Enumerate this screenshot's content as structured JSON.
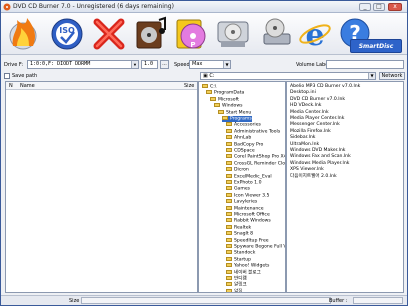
{
  "window": {
    "title": "DVD CD Burner 7.0 - Unregistered (6 days remaining)"
  },
  "toolbar": {
    "buttons": [
      {
        "icon": "burn-flame-icon"
      },
      {
        "icon": "iso-disc-icon",
        "label": "ISO"
      },
      {
        "icon": "erase-x-icon"
      },
      {
        "icon": "music-disc-icon"
      },
      {
        "icon": "dvd-disc-icon"
      },
      {
        "icon": "settings-disc-icon"
      },
      {
        "icon": "copy-drive-icon"
      },
      {
        "icon": "internet-explorer-icon"
      },
      {
        "icon": "help-question-icon",
        "label": "?"
      }
    ],
    "brand_label": "SmartDisc"
  },
  "drive": {
    "label": "Drive F:",
    "value": "1:0:0,F: DIODT  DDRMM",
    "speed_value": "1.0",
    "browse_label": "...",
    "speed_label": "Speed:",
    "speed_select": "Max",
    "volume_label": "Volume Label:"
  },
  "options": {
    "save_path_label": "Save path",
    "drive_select": "▣ C:",
    "network_label": "Network"
  },
  "file_list": {
    "columns": [
      "N",
      "Name",
      "Size"
    ]
  },
  "tree": {
    "items": [
      {
        "label": "C:\\",
        "depth": 0
      },
      {
        "label": "ProgramData",
        "depth": 1
      },
      {
        "label": "Microsoft",
        "depth": 2
      },
      {
        "label": "Windows",
        "depth": 3
      },
      {
        "label": "Start Menu",
        "depth": 4
      },
      {
        "label": "Programs",
        "depth": 5,
        "selected": true
      },
      {
        "label": "Accessories",
        "depth": 6
      },
      {
        "label": "Administrative Tools",
        "depth": 6
      },
      {
        "label": "AhnLab",
        "depth": 6
      },
      {
        "label": "BadCopy Pro",
        "depth": 6
      },
      {
        "label": "CDSpace",
        "depth": 6
      },
      {
        "label": "Corel PaintShop Pro X4",
        "depth": 6
      },
      {
        "label": "CrossGL Reminder Clock",
        "depth": 6
      },
      {
        "label": "Dicron",
        "depth": 6
      },
      {
        "label": "ExcelMedic_Eval",
        "depth": 6
      },
      {
        "label": "ExPhoto 1.0",
        "depth": 6
      },
      {
        "label": "Games",
        "depth": 6
      },
      {
        "label": "Icon Viewer 3.5",
        "depth": 6
      },
      {
        "label": "Lavyleries",
        "depth": 6
      },
      {
        "label": "Maintenance",
        "depth": 6
      },
      {
        "label": "Microsoft Office",
        "depth": 6
      },
      {
        "label": "Rabbit Windows",
        "depth": 6
      },
      {
        "label": "Realtek",
        "depth": 6
      },
      {
        "label": "SnagIt 8",
        "depth": 6
      },
      {
        "label": "SpeedItup Free",
        "depth": 6
      },
      {
        "label": "Spyware Begone Full Version",
        "depth": 6
      },
      {
        "label": "Standock",
        "depth": 6
      },
      {
        "label": "Startup",
        "depth": 6
      },
      {
        "label": "Yahoo! Widgets",
        "depth": 6
      },
      {
        "label": "네이버 블로그",
        "depth": 6
      },
      {
        "label": "반디캠",
        "depth": 6
      },
      {
        "label": "알링크",
        "depth": 6
      },
      {
        "label": "알집",
        "depth": 6
      }
    ]
  },
  "files": {
    "items": [
      "Abelio MP3 CD Burner v7.0.lnk",
      "Desktop.ini",
      "DVD CD Burner v7.0.lnk",
      "HD VDeck.lnk",
      "Media Center.lnk",
      "Media Player Center.lnk",
      "Messenger Center.lnk",
      "Mozilla Firefox.lnk",
      "Sidebar.lnk",
      "UltraMon.lnk",
      "Windows DVD Maker.lnk",
      "Windows Fax and Scan.lnk",
      "Windows Media Player.lnk",
      "XPS Viewer.lnk",
      "다음이지트웰어 2.0.lnk"
    ]
  },
  "status": {
    "size_label": "Size",
    "buffer_label": "Buffer :"
  }
}
